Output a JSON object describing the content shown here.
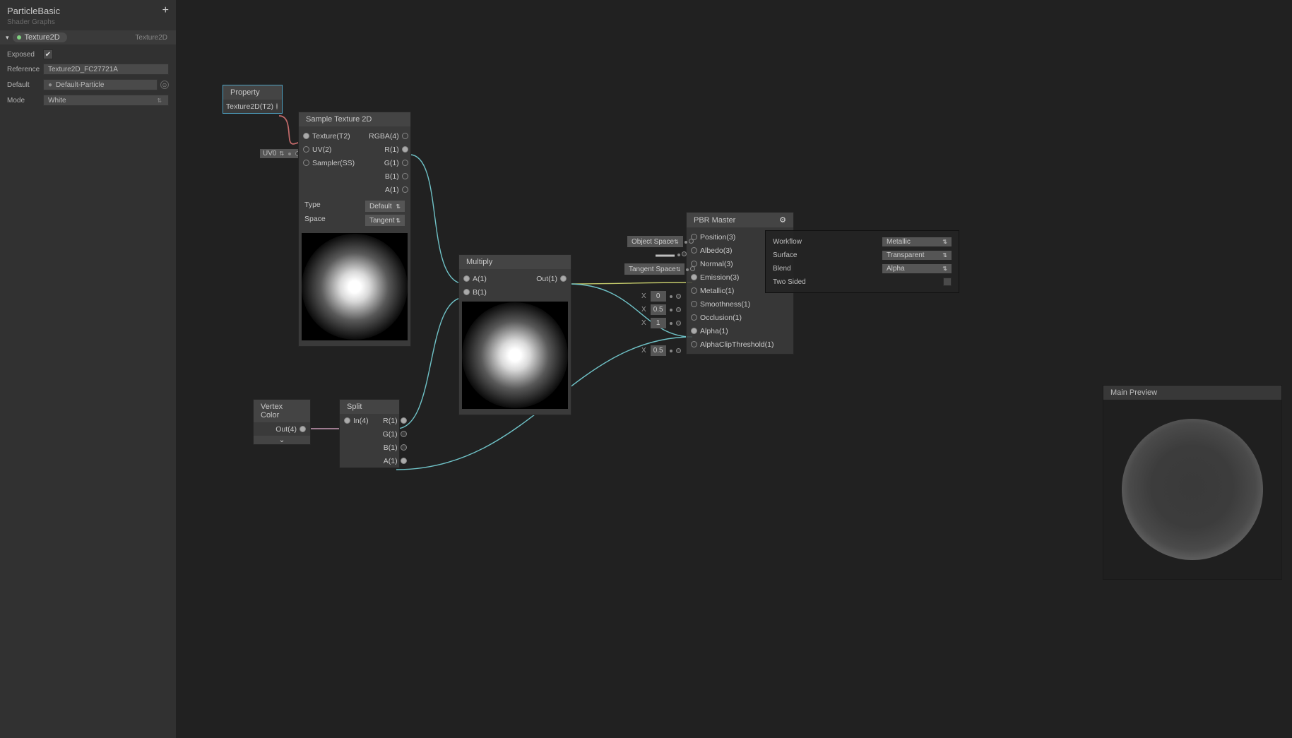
{
  "side": {
    "title": "ParticleBasic",
    "sub": "Shader Graphs",
    "add": "+",
    "var": {
      "name": "Texture2D",
      "type": "Texture2D"
    },
    "exposed": {
      "label": "Exposed",
      "checked": "✔"
    },
    "reference": {
      "label": "Reference",
      "value": "Texture2D_FC27721A"
    },
    "default": {
      "label": "Default",
      "value": "Default-Particle"
    },
    "mode": {
      "label": "Mode",
      "value": "White"
    },
    "collapse": "▾"
  },
  "nodes": {
    "property": {
      "title": "Property",
      "out": "Texture2D(T2)"
    },
    "sample": {
      "title": "Sample Texture 2D",
      "in": {
        "texture": "Texture(T2)",
        "uv": "UV(2)",
        "sampler": "Sampler(SS)"
      },
      "out": {
        "rgba": "RGBA(4)",
        "r": "R(1)",
        "g": "G(1)",
        "b": "B(1)",
        "a": "A(1)"
      },
      "params": {
        "typeL": "Type",
        "typeV": "Default",
        "spaceL": "Space",
        "spaceV": "Tangent"
      },
      "uvChip": "UV0"
    },
    "multiply": {
      "title": "Multiply",
      "in": {
        "a": "A(1)",
        "b": "B(1)"
      },
      "out": "Out(1)"
    },
    "vertexColor": {
      "title": "Vertex Color",
      "out": "Out(4)",
      "expand": "⌄"
    },
    "split": {
      "title": "Split",
      "in": "In(4)",
      "out": {
        "r": "R(1)",
        "g": "G(1)",
        "b": "B(1)",
        "a": "A(1)"
      }
    },
    "pbr": {
      "title": "PBR Master",
      "gear": "⚙",
      "slots": {
        "position": {
          "label": "Position(3)",
          "space": "Object Space"
        },
        "albedo": {
          "label": "Albedo(3)"
        },
        "normal": {
          "label": "Normal(3)",
          "space": "Tangent Space"
        },
        "emission": {
          "label": "Emission(3)"
        },
        "metallic": {
          "label": "Metallic(1)",
          "x": "0"
        },
        "smoothness": {
          "label": "Smoothness(1)",
          "x": "0.5"
        },
        "occlusion": {
          "label": "Occlusion(1)",
          "x": "1"
        },
        "alpha": {
          "label": "Alpha(1)"
        },
        "acthresh": {
          "label": "AlphaClipThreshold(1)",
          "x": "0.5"
        }
      },
      "xlabel": "X"
    },
    "settings": {
      "workflowL": "Workflow",
      "workflowV": "Metallic",
      "surfaceL": "Surface",
      "surfaceV": "Transparent",
      "blendL": "Blend",
      "blendV": "Alpha",
      "twoSidedL": "Two Sided"
    }
  },
  "mainPreview": "Main Preview",
  "caret": "▾",
  "updn": "⇅"
}
